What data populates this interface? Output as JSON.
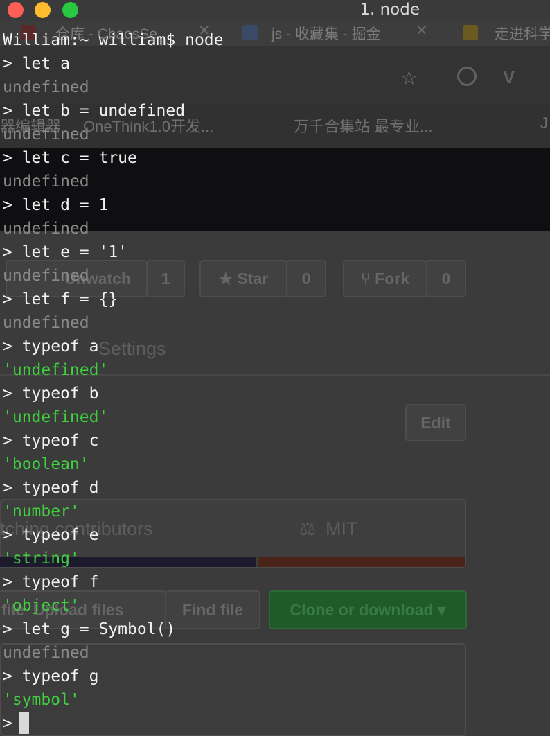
{
  "window": {
    "title": "1. node"
  },
  "background_browser": {
    "tabs": [
      {
        "label": "仓库 - ChaosSe"
      },
      {
        "label": "js - 收藏集 - 掘金"
      },
      {
        "label": "走进科学"
      }
    ],
    "bookmarks": [
      {
        "label": "器编辑器"
      },
      {
        "label": "OneThink1.0开发..."
      },
      {
        "label": "万千合集站 最专业..."
      },
      {
        "label": "J"
      }
    ],
    "repo_buttons": {
      "unwatch_label": "Unwatch",
      "watch_count": "1",
      "star_label": "Star",
      "star_count": "0",
      "fork_label": "Fork",
      "fork_count": "0"
    },
    "settings_label": "Settings",
    "edit_label": "Edit",
    "contributors_label": "tching contributors",
    "license_label": "MIT",
    "file_buttons": {
      "file_label": "file",
      "upload_label": "Upload files",
      "find_label": "Find file",
      "clone_label": "Clone or download"
    },
    "colors": {
      "bar_left": "#1d1a2e",
      "bar_right": "#4a2418",
      "clone_green": "#1e5a2a"
    }
  },
  "terminal": {
    "lines": [
      {
        "kind": "header",
        "text": "William:~ william$ node"
      },
      {
        "kind": "input",
        "text": "> let a"
      },
      {
        "kind": "undef",
        "text": "undefined"
      },
      {
        "kind": "input",
        "text": "> let b = undefined"
      },
      {
        "kind": "undef",
        "text": "undefined"
      },
      {
        "kind": "input",
        "text": "> let c = true"
      },
      {
        "kind": "undef",
        "text": "undefined"
      },
      {
        "kind": "input",
        "text": "> let d = 1"
      },
      {
        "kind": "undef",
        "text": "undefined"
      },
      {
        "kind": "input",
        "text": "> let e = '1'"
      },
      {
        "kind": "undef",
        "text": "undefined"
      },
      {
        "kind": "input",
        "text": "> let f = {}"
      },
      {
        "kind": "undef",
        "text": "undefined"
      },
      {
        "kind": "input",
        "text": "> typeof a"
      },
      {
        "kind": "str",
        "text": "'undefined'"
      },
      {
        "kind": "input",
        "text": "> typeof b"
      },
      {
        "kind": "str",
        "text": "'undefined'"
      },
      {
        "kind": "input",
        "text": "> typeof c"
      },
      {
        "kind": "str",
        "text": "'boolean'"
      },
      {
        "kind": "input",
        "text": "> typeof d"
      },
      {
        "kind": "str",
        "text": "'number'"
      },
      {
        "kind": "input",
        "text": "> typeof e"
      },
      {
        "kind": "str",
        "text": "'string'"
      },
      {
        "kind": "input",
        "text": "> typeof f"
      },
      {
        "kind": "str",
        "text": "'object'"
      },
      {
        "kind": "input",
        "text": "> let g = Symbol()"
      },
      {
        "kind": "undef",
        "text": "undefined"
      },
      {
        "kind": "input",
        "text": "> typeof g"
      },
      {
        "kind": "str",
        "text": "'symbol'"
      }
    ],
    "prompt": ">",
    "colors": {
      "string_output": "#3fcf3f",
      "undefined_output": "#8a8a8a",
      "input_text": "#f2f2f2"
    }
  }
}
